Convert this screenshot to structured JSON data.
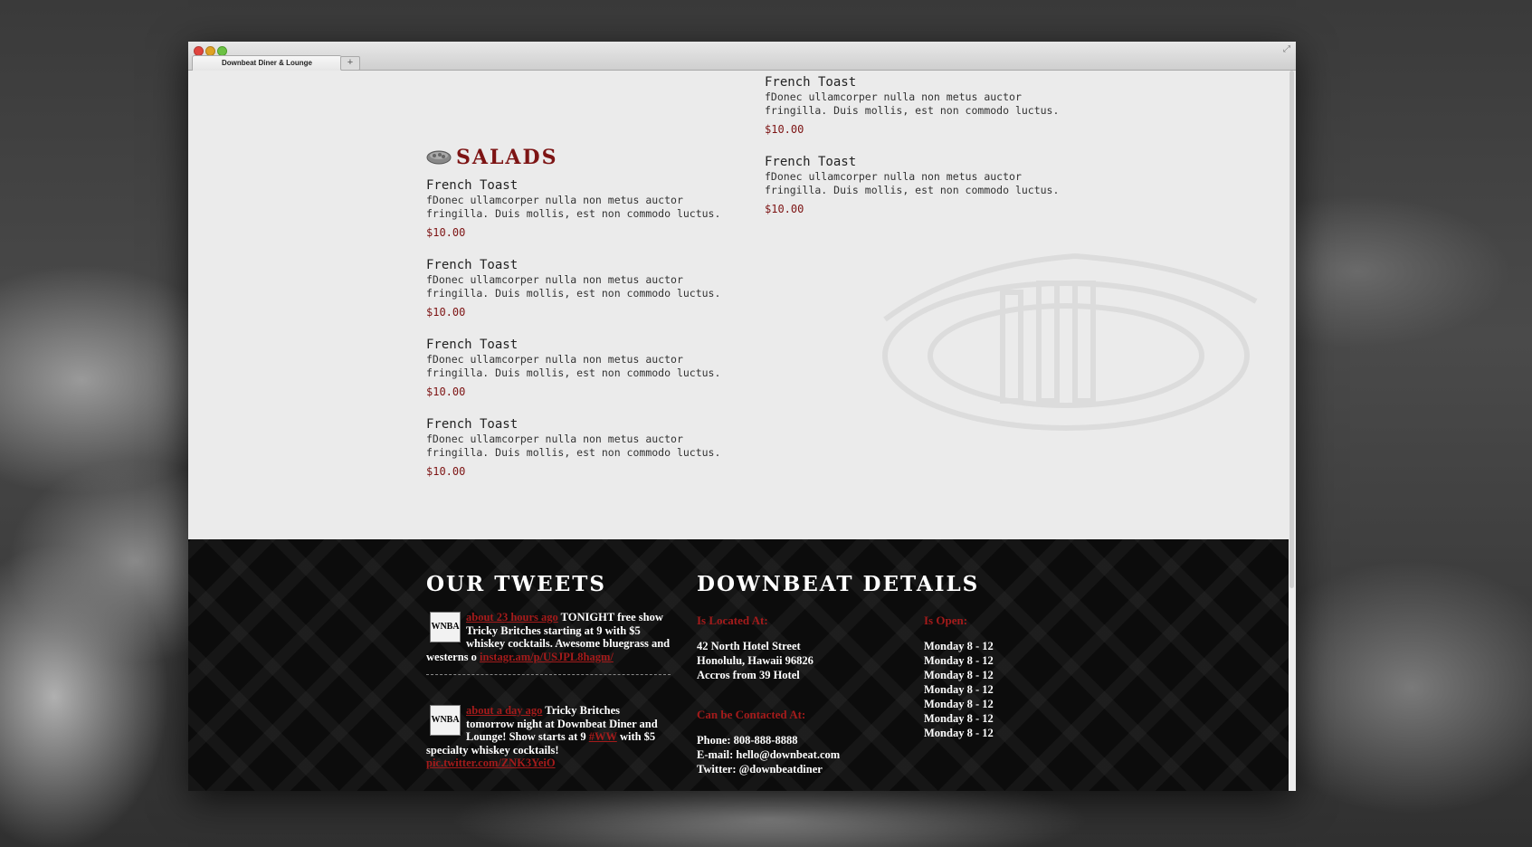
{
  "browser": {
    "tab_title": "Downbeat Diner & Lounge",
    "new_tab": "+",
    "resize": "⤢"
  },
  "menu": {
    "section_title": "SALADS",
    "section_icon": "salad-bowl-icon",
    "left_items": [
      {
        "name": "French Toast",
        "desc": "fDonec ullamcorper nulla non metus auctor fringilla. Duis mollis, est non commodo luctus.",
        "price": "$10.00"
      },
      {
        "name": "French Toast",
        "desc": "fDonec ullamcorper nulla non metus auctor fringilla. Duis mollis, est non commodo luctus.",
        "price": "$10.00"
      },
      {
        "name": "French Toast",
        "desc": "fDonec ullamcorper nulla non metus auctor fringilla. Duis mollis, est non commodo luctus.",
        "price": "$10.00"
      },
      {
        "name": "French Toast",
        "desc": "fDonec ullamcorper nulla non metus auctor fringilla. Duis mollis, est non commodo luctus.",
        "price": "$10.00"
      }
    ],
    "right_items": [
      {
        "name": "French Toast",
        "desc": "fDonec ullamcorper nulla non metus auctor fringilla. Duis mollis, est non commodo luctus.",
        "price": "$10.00"
      },
      {
        "name": "French Toast",
        "desc": "fDonec ullamcorper nulla non metus auctor fringilla. Duis mollis, est non commodo luctus.",
        "price": "$10.00"
      }
    ],
    "accent_color": "#7d1414"
  },
  "footer": {
    "tweets_title": "OUR TWEETS",
    "tweets": [
      {
        "avatar": "WNBA",
        "time": "about 23 hours ago",
        "text": " TONIGHT free show Tricky Britches starting at 9 with $5 whiskey cocktails. Awesome bluegrass and westerns o ",
        "link": "instagr.am/p/USJPL8hagm/",
        "hashtag": ""
      },
      {
        "avatar": "WNBA",
        "time": "about a day ago",
        "text": " Tricky Britches tomorrow night at Downbeat Diner and Lounge! Show starts at 9 ",
        "hashtag": "#WW",
        "text2": " with $5 specialty whiskey cocktails! ",
        "link": "pic.twitter.com/ZNK3YeiO"
      }
    ],
    "details_title": "DOWNBEAT DETAILS",
    "located_label": "Is Located At:",
    "address": [
      "42 North Hotel Street",
      "Honolulu, Hawaii 96826",
      "Accros from 39 Hotel"
    ],
    "contact_label": "Can be Contacted At:",
    "contact": [
      "Phone: 808-888-8888",
      "E-mail: hello@downbeat.com",
      "Twitter: @downbeatdiner"
    ],
    "open_label": "Is Open:",
    "hours": [
      "Monday 8 - 12",
      "Monday 8 - 12",
      "Monday 8 - 12",
      "Monday 8 - 12",
      "Monday 8 - 12",
      "Monday 8 - 12",
      "Monday 8 - 12"
    ],
    "accent_color": "#a41b1b"
  }
}
